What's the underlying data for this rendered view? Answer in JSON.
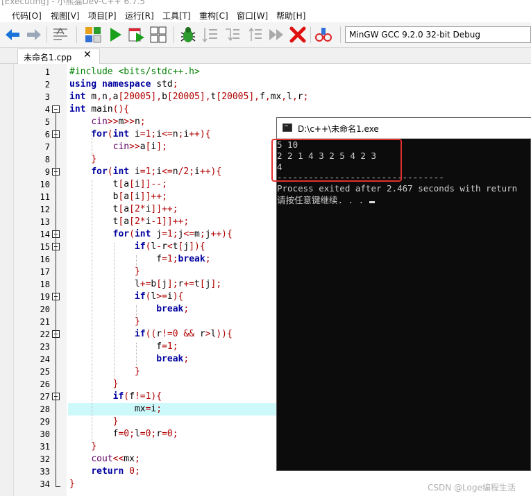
{
  "window": {
    "title": "[Executing] - 小熊猫Dev-C++ 6.7.5"
  },
  "menu": {
    "items": [
      "代码[O]",
      "视图[V]",
      "项目[P]",
      "运行[R]",
      "工具[T]",
      "重构[C]",
      "窗口[W]",
      "帮助[H]"
    ]
  },
  "toolbar": {
    "compiler_select": "MinGW GCC 9.2.0 32-bit Debug",
    "icons": [
      "back-arrow-icon",
      "forward-arrow-icon",
      "format-icon",
      "compile-icon",
      "run-icon",
      "compile-run-icon",
      "rebuild-icon",
      "debug-icon",
      "step-over-icon",
      "step-into-icon",
      "step-out-icon",
      "continue-icon",
      "stop-icon",
      "problem-icon"
    ],
    "colors": {
      "back": "#1a73d9",
      "run": "#1aa01a",
      "stop": "#e01010",
      "debug": "#2e9b2e"
    }
  },
  "editor": {
    "tab_label": "未命名1.cpp",
    "tab_close": "✕",
    "line_numbers": [
      "1",
      "2",
      "3",
      "4",
      "5",
      "6",
      "7",
      "8",
      "9",
      "10",
      "11",
      "12",
      "13",
      "14",
      "15",
      "16",
      "17",
      "18",
      "19",
      "20",
      "21",
      "22",
      "23",
      "24",
      "25",
      "26",
      "27",
      "28",
      "29",
      "30",
      "31",
      "32",
      "33",
      "34"
    ],
    "lines": [
      "#include <bits/stdc++.h>",
      "using namespace std;",
      "int m,n,a[20005],b[20005],t[20005],f,mx,l,r;",
      "int main(){",
      "    cin>>m>>n;",
      "    for(int i=1;i<=n;i++){",
      "        cin>>a[i];",
      "    }",
      "    for(int i=1;i<=n/2;i++){",
      "        t[a[i]]--;",
      "        b[a[i]]++;",
      "        t[a[2*i]]++;",
      "        t[a[2*i-1]]++;",
      "        for(int j=1;j<=m;j++){",
      "            if(l-r<t[j]){",
      "                f=1;break;",
      "            }",
      "            l+=b[j];r+=t[j];",
      "            if(l>=i){",
      "                break;",
      "            }",
      "            if((r!=0 && r>l)){",
      "                f=1;",
      "                break;",
      "            }",
      "        }",
      "        if(f!=1){",
      "            mx=i;",
      "        }",
      "        f=0;l=0;r=0;",
      "    }",
      "    cout<<mx;",
      "    return 0;",
      "}"
    ],
    "highlighted_line": 28,
    "colors": {
      "keyword": "#0000a0",
      "symbol": "#b00000",
      "preprocessor": "#008000",
      "highlight": "#cdf9fb"
    }
  },
  "console": {
    "title": "D:\\c++\\未命名1.exe",
    "lines": [
      "5 10",
      "2 2 1 4 3 2 5 4 2 3",
      "4",
      "--------------------------------",
      "Process exited after 2.467 seconds with return",
      "请按任意键继续. . . "
    ]
  },
  "watermark": "CSDN @Loge编程生活"
}
